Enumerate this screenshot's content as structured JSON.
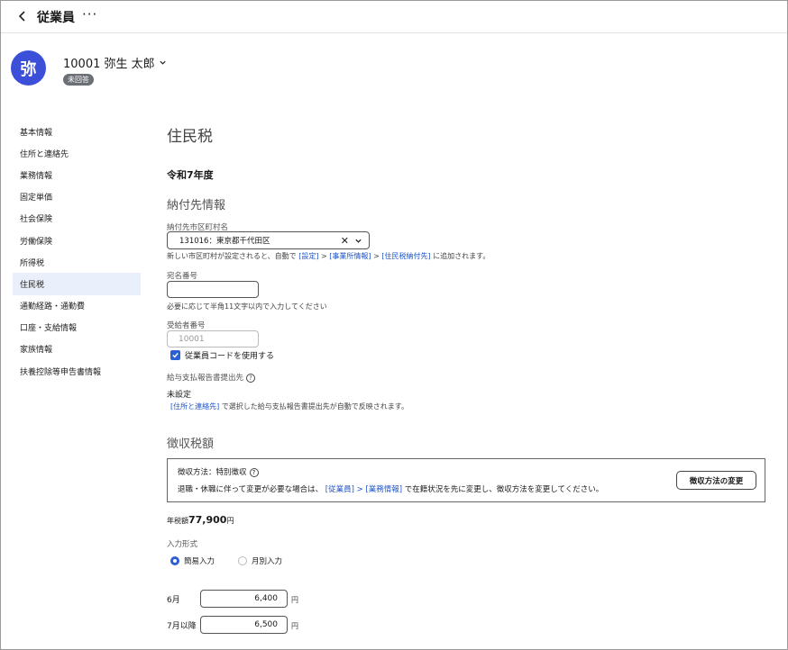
{
  "header": {
    "title": "従業員",
    "more": "···"
  },
  "employee": {
    "name": "10001 弥生 太郎",
    "avatar_char": "弥",
    "status": "未回答"
  },
  "sidebar": {
    "items": [
      {
        "label": "基本情報"
      },
      {
        "label": "住所と連絡先"
      },
      {
        "label": "業務情報"
      },
      {
        "label": "固定単価"
      },
      {
        "label": "社会保険"
      },
      {
        "label": "労働保険"
      },
      {
        "label": "所得税"
      },
      {
        "label": "住民税"
      },
      {
        "label": "通勤経路・通勤費"
      },
      {
        "label": "口座・支給情報"
      },
      {
        "label": "家族情報"
      },
      {
        "label": "扶養控除等申告書情報"
      }
    ],
    "active_index": 7
  },
  "main": {
    "title": "住民税",
    "year": "令和7年度",
    "payee": {
      "heading": "納付先情報",
      "municipality_label": "納付先市区町村名",
      "municipality_value": "131016：東京都千代田区",
      "note_prefix": "新しい市区町村が設定されると、自動で",
      "note_link1": "[設定]",
      "note_sep1": ">",
      "note_link2": "[事業所情報]",
      "note_sep2": ">",
      "note_link3": "[住民税納付先]",
      "note_suffix": "に追加されます。",
      "addressee_label": "宛名番号",
      "addressee_value": "",
      "addressee_hint": "必要に応じて半角11文字以内で入力してください",
      "recipient_label": "受給者番号",
      "recipient_placeholder": "10001",
      "use_code_label": "従業員コードを使用する",
      "use_code_checked": true,
      "report_dest_label": "給与支払報告書提出先",
      "report_dest_value": "未設定",
      "report_link": "[住所と連絡先]",
      "report_note": "で選択した給与支払報告書提出先が自動で反映されます。"
    },
    "tax": {
      "heading": "徴収税額",
      "method_label": "徴収方法：特別徴収",
      "method_note_prefix": "退職・休職に伴って変更が必要な場合は、",
      "method_link1": "[従業員]",
      "method_sep": ">",
      "method_link2": "[業務情報]",
      "method_note_suffix": "で在籍状況を先に変更し、徴収方法を変更してください。",
      "change_button": "徴収方法の変更",
      "annual_label": "年税額",
      "annual_value": "77,900",
      "annual_unit": "円",
      "input_type_label": "入力形式",
      "options": [
        {
          "label": "簡易入力",
          "selected": true
        },
        {
          "label": "月別入力",
          "selected": false
        }
      ],
      "june_label": "6月",
      "june_value": "6,400",
      "july_label": "7月以降",
      "july_value": "6,500",
      "unit": "円"
    }
  }
}
